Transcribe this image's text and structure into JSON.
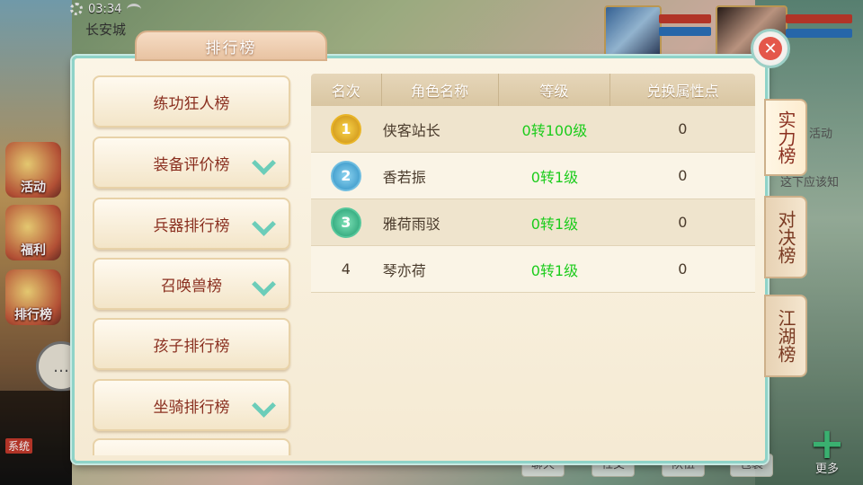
{
  "status_bar": {
    "time": "03:34"
  },
  "location": "长安城",
  "side_buttons": [
    {
      "label": "活动"
    },
    {
      "label": "福利"
    },
    {
      "label": "排行榜"
    }
  ],
  "chat": {
    "channel": "系统"
  },
  "bottom_buttons": [
    "聊天",
    "社交",
    "队伍",
    "包裹"
  ],
  "more_label": "更多",
  "background_text": {
    "activity": "活动",
    "hint": "这下应该知"
  },
  "panel": {
    "title": "排行榜",
    "left_categories": [
      {
        "label": "练功狂人榜",
        "expandable": false
      },
      {
        "label": "装备评价榜",
        "expandable": true
      },
      {
        "label": "兵器排行榜",
        "expandable": true
      },
      {
        "label": "召唤兽榜",
        "expandable": true
      },
      {
        "label": "孩子排行榜",
        "expandable": false
      },
      {
        "label": "坐骑排行榜",
        "expandable": true
      }
    ],
    "table": {
      "headers": [
        "名次",
        "角色名称",
        "等级",
        "兑换属性点"
      ],
      "rows": [
        {
          "rank": "1",
          "name": "侠客站长",
          "level": "0转100级",
          "points": "0"
        },
        {
          "rank": "2",
          "name": "香若振",
          "level": "0转1级",
          "points": "0"
        },
        {
          "rank": "3",
          "name": "雅荷雨驳",
          "level": "0转1级",
          "points": "0"
        },
        {
          "rank": "4",
          "name": "琴亦荷",
          "level": "0转1级",
          "points": "0"
        }
      ]
    },
    "right_tabs": [
      {
        "label": "实力榜",
        "active": true
      },
      {
        "label": "对决榜",
        "active": false
      },
      {
        "label": "江湖榜",
        "active": false
      }
    ]
  },
  "colors": {
    "level_text": "#1ccc1c",
    "close_red": "#e4574a",
    "accent_teal": "#6ccdb9"
  }
}
